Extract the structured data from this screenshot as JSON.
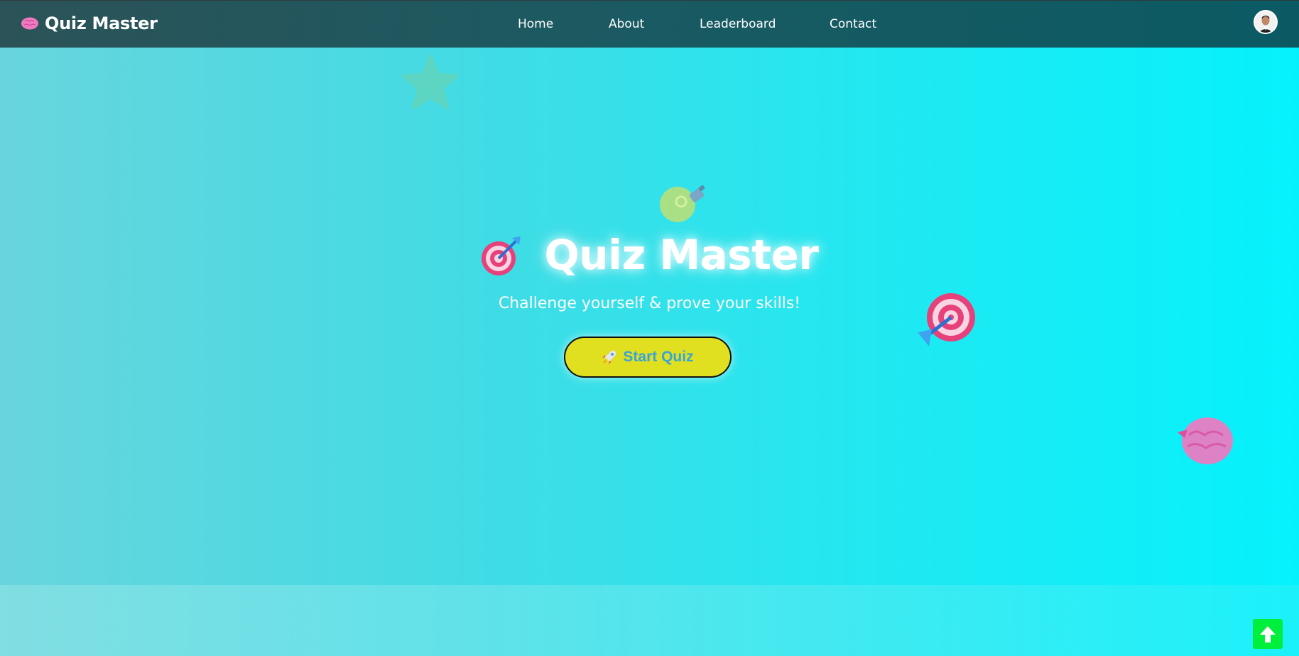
{
  "navbar": {
    "brand_title": "Quiz Master",
    "brand_icon": "brain-icon",
    "links": [
      {
        "label": "Home"
      },
      {
        "label": "About"
      },
      {
        "label": "Leaderboard"
      },
      {
        "label": "Contact"
      }
    ],
    "avatar_icon": "user-avatar"
  },
  "hero": {
    "title": "Quiz Master",
    "title_icon": "target-icon",
    "subtitle": "Challenge yourself & prove your skills!",
    "start_button": {
      "label": "Start Quiz",
      "icon": "rocket-icon"
    }
  },
  "decorations": [
    "star-icon",
    "lightbulb-icon",
    "target-icon",
    "brain-icon"
  ],
  "scroll_top_icon": "arrow-up-icon",
  "colors": {
    "nav_bg": "#1a5a62",
    "hero_left": "#68d5dc",
    "hero_right": "#05f2fc",
    "button_bg": "#e0e021",
    "button_text": "#39a4d8",
    "scroll_top_bg": "#00ee3c"
  }
}
